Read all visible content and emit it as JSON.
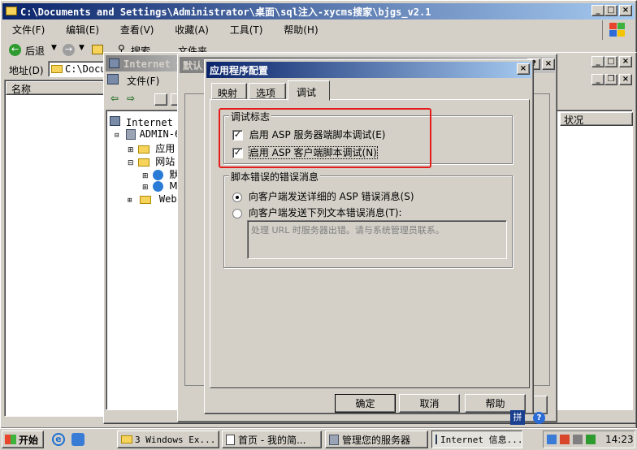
{
  "explorer": {
    "title": "C:\\Documents and Settings\\Administrator\\桌面\\sql注入-xycms搜家\\bjgs_v2.1",
    "menu": [
      "文件(F)",
      "编辑(E)",
      "查看(V)",
      "收藏(A)",
      "工具(T)",
      "帮助(H)"
    ],
    "back_label": "后退",
    "search_label": "搜索",
    "folders_label": "文件夹",
    "address_label": "地址(D)",
    "address_value": "C:\\Docum",
    "column_name": "名称"
  },
  "iis": {
    "title": "Internet 信",
    "menu": [
      "文件(F)",
      "操"
    ],
    "tree": [
      {
        "label": "Internet 信",
        "indent": 0
      },
      {
        "label": "ADMIN-60",
        "indent": 1
      },
      {
        "label": "应用",
        "indent": 2
      },
      {
        "label": "网站",
        "indent": 2
      },
      {
        "label": "默",
        "indent": 3
      },
      {
        "label": "M",
        "indent": 3
      },
      {
        "label": "Web",
        "indent": 2
      }
    ],
    "status_column": "状况"
  },
  "props_window": {
    "title": "默认"
  },
  "dialog": {
    "title": "应用程序配置",
    "tabs": [
      "映射",
      "选项",
      "调试"
    ],
    "active_tab": 2,
    "debug_group": {
      "label": "调试标志",
      "asp_server_debug": "启用 ASP 服务器端脚本调试(E)",
      "asp_client_debug": "启用 ASP 客户端脚本调试(N)"
    },
    "error_group": {
      "label": "脚本错误的错误消息",
      "send_detailed": "向客户端发送详细的 ASP 错误消息(S)",
      "send_text": "向客户端发送下列文本错误消息(T):",
      "text_value": "处理 URL 时服务器出错。请与系统管理员联系。"
    },
    "ok_label": "确定",
    "cancel_label": "取消",
    "help_label": "帮助",
    "highlight_color": "#e41c1c"
  },
  "taskbar": {
    "start_label": "开始",
    "tasks": [
      "3 Windows Ex...",
      "首页 - 我的简...",
      "管理您的服务器",
      "Internet 信息..."
    ],
    "clock": "14:23"
  }
}
